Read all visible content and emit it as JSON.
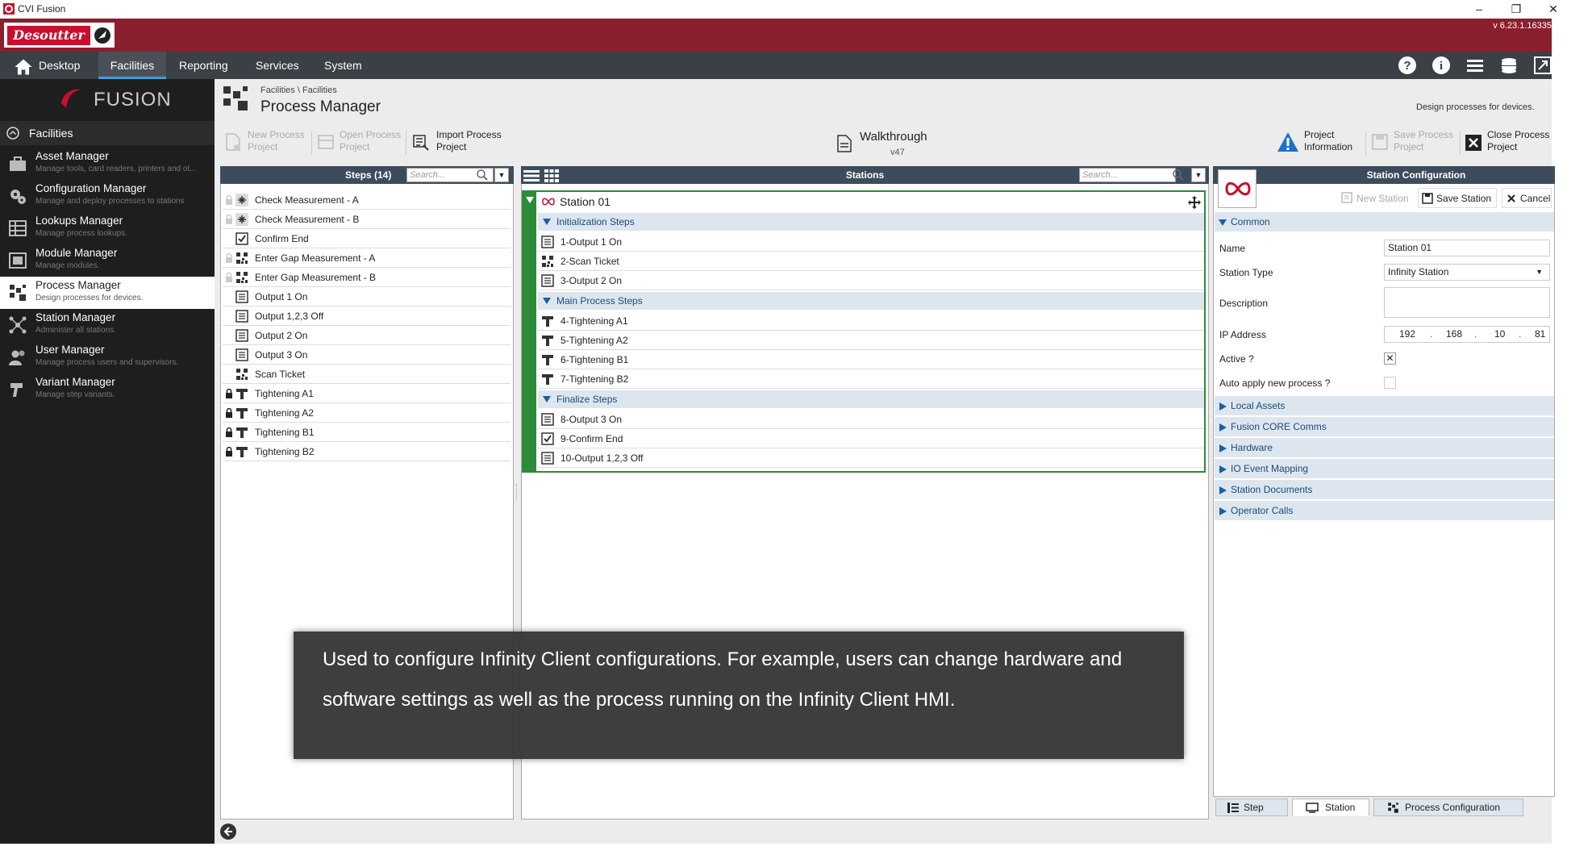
{
  "window": {
    "title": "CVI Fusion",
    "version": "v 6.23.1.16335"
  },
  "brand": {
    "logo_text": "Desoutter"
  },
  "nav": {
    "items": [
      "Desktop",
      "Facilities",
      "Reporting",
      "Services",
      "System"
    ]
  },
  "sidebar": {
    "logo_text": "FUSION",
    "section": "Facilities",
    "items": [
      {
        "title": "Asset Manager",
        "subtitle": "Manage tools, card readers, printers and ot..."
      },
      {
        "title": "Configuration Manager",
        "subtitle": "Manage and deploy processes to stations"
      },
      {
        "title": "Lookups Manager",
        "subtitle": "Manage process lookups."
      },
      {
        "title": "Module Manager",
        "subtitle": "Manage modules."
      },
      {
        "title": "Process Manager",
        "subtitle": "Design processes for devices."
      },
      {
        "title": "Station Manager",
        "subtitle": "Administer all stations."
      },
      {
        "title": "User Manager",
        "subtitle": "Manage process users and supervisors."
      },
      {
        "title": "Variant Manager",
        "subtitle": "Manage step variants."
      }
    ]
  },
  "header": {
    "breadcrumb": "Facilities \\ Facilities",
    "title": "Process Manager",
    "description": "Design processes for devices."
  },
  "toolbar": {
    "new_process_project": "New Process Project",
    "open_process_project": "Open Process Project",
    "import_process_project": "Import Process Project",
    "project_name": "Walkthrough",
    "project_version": "v47",
    "project_information": "Project Information",
    "save_process_project": "Save Process Project",
    "close_process_project": "Close Process Project"
  },
  "steps_panel": {
    "title": "Steps (14)",
    "search_placeholder": "Search...",
    "steps": [
      {
        "label": "Check Measurement - A",
        "icon": "measure-icon",
        "lock": "light"
      },
      {
        "label": "Check Measurement - B",
        "icon": "measure-icon",
        "lock": "light"
      },
      {
        "label": "Confirm End",
        "icon": "confirm-icon",
        "lock": "none"
      },
      {
        "label": "Enter Gap Measurement - A",
        "icon": "qr-icon",
        "lock": "light"
      },
      {
        "label": "Enter Gap Measurement - B",
        "icon": "qr-icon",
        "lock": "light"
      },
      {
        "label": "Output 1 On",
        "icon": "output-icon",
        "lock": "none"
      },
      {
        "label": "Output 1,2,3 Off",
        "icon": "output-icon",
        "lock": "none"
      },
      {
        "label": "Output 2 On",
        "icon": "output-icon",
        "lock": "none"
      },
      {
        "label": "Output 3 On",
        "icon": "output-icon",
        "lock": "none"
      },
      {
        "label": "Scan Ticket",
        "icon": "qr-icon",
        "lock": "none"
      },
      {
        "label": "Tightening A1",
        "icon": "tightening-icon",
        "lock": "dark"
      },
      {
        "label": "Tightening A2",
        "icon": "tightening-icon",
        "lock": "dark"
      },
      {
        "label": "Tightening B1",
        "icon": "tightening-icon",
        "lock": "dark"
      },
      {
        "label": "Tightening B2",
        "icon": "tightening-icon",
        "lock": "dark"
      }
    ]
  },
  "stations_panel": {
    "title": "Stations",
    "search_placeholder": "Search...",
    "station_name": "Station 01",
    "groups": [
      {
        "name": "Initialization Steps",
        "steps": [
          {
            "label": "1-Output 1 On",
            "icon": "output-icon"
          },
          {
            "label": "2-Scan Ticket",
            "icon": "qr-icon"
          },
          {
            "label": "3-Output 2 On",
            "icon": "output-icon"
          }
        ]
      },
      {
        "name": "Main Process Steps",
        "steps": [
          {
            "label": "4-Tightening A1",
            "icon": "tightening-icon"
          },
          {
            "label": "5-Tightening A2",
            "icon": "tightening-icon"
          },
          {
            "label": "6-Tightening B1",
            "icon": "tightening-icon"
          },
          {
            "label": "7-Tightening B2",
            "icon": "tightening-icon"
          }
        ]
      },
      {
        "name": "Finalize Steps",
        "steps": [
          {
            "label": "8-Output 3 On",
            "icon": "output-icon"
          },
          {
            "label": "9-Confirm End",
            "icon": "confirm-icon"
          },
          {
            "label": "10-Output 1,2,3 Off",
            "icon": "output-icon"
          }
        ]
      }
    ]
  },
  "config_panel": {
    "title": "Station Configuration",
    "new_station": "New Station",
    "save_station": "Save Station",
    "cancel": "Cancel",
    "common_section": "Common",
    "fields": {
      "name_label": "Name",
      "name_value": "Station 01",
      "type_label": "Station Type",
      "type_value": "Infinity Station",
      "description_label": "Description",
      "description_value": "",
      "ip_label": "IP Address",
      "ip": [
        "192",
        "168",
        "10",
        "81"
      ],
      "active_label": "Active ?",
      "active_checked": true,
      "auto_label": "Auto apply new process ?",
      "auto_checked": false
    },
    "sections": [
      "Local Assets",
      "Fusion CORE Comms",
      "Hardware",
      "IO Event Mapping",
      "Station Documents",
      "Operator Calls"
    ]
  },
  "bottom_tabs": [
    "Step",
    "Station",
    "Process Configuration"
  ],
  "caption": "Used to configure Infinity Client configurations. For example, users can change hardware and software settings as well as the process running on the Infinity Client HMI.",
  "colors": {
    "brand_red": "#8a1f2e",
    "nav_bg": "#3b3f46",
    "panel_header": "#3d4c5c",
    "station_green": "#2e8b3a",
    "accent_blue": "#3aa0e0"
  }
}
